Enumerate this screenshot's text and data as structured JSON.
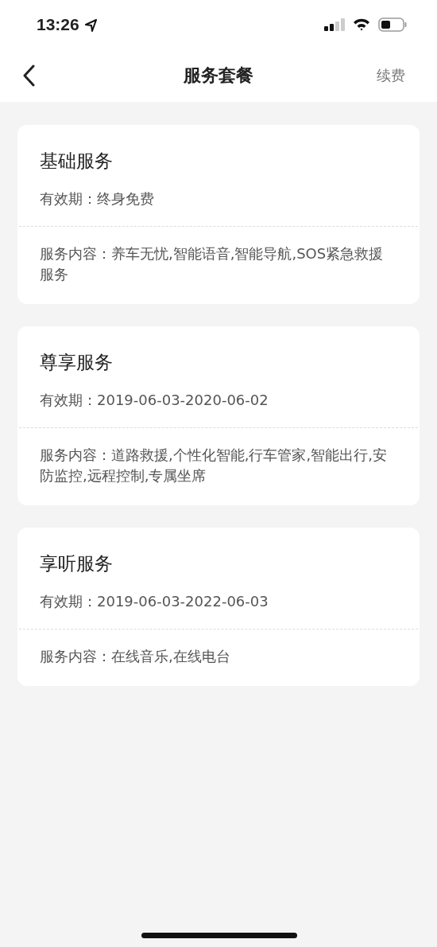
{
  "status_bar": {
    "time": "13:26"
  },
  "nav": {
    "title": "服务套餐",
    "action": "续费"
  },
  "packages": [
    {
      "name": "基础服务",
      "validity": "有效期：终身免费",
      "content": "服务内容：养车无忧,智能语音,智能导航,SOS紧急救援服务"
    },
    {
      "name": "尊享服务",
      "validity": "有效期：2019-06-03-2020-06-02",
      "content": "服务内容：道路救援,个性化智能,行车管家,智能出行,安防监控,远程控制,专属坐席"
    },
    {
      "name": "享听服务",
      "validity": "有效期：2019-06-03-2022-06-03",
      "content": "服务内容：在线音乐,在线电台"
    }
  ]
}
